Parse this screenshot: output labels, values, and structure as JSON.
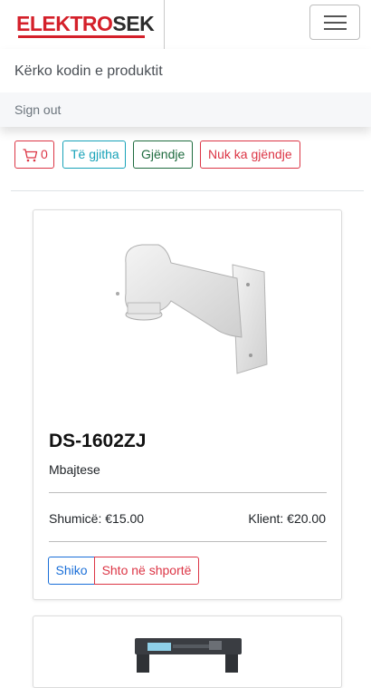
{
  "brand": {
    "part1": "ELEKTRO",
    "part2": "SEK",
    "accent_color": "#d4202a"
  },
  "menu": {
    "search_placeholder": "Kërko kodin e produktit",
    "signout_label": "Sign out"
  },
  "filters": {
    "cart_count": "0",
    "all_label": "Të gjitha",
    "in_stock_label": "Gjëndje",
    "out_of_stock_label": "Nuk ka gjëndje"
  },
  "products": [
    {
      "code": "DS-1602ZJ",
      "description": "Mbajtese",
      "wholesale_price": "Shumicë: €15.00",
      "client_price": "Klient: €20.00",
      "view_label": "Shiko",
      "add_label": "Shto në shportë",
      "image_icon": "wall-mount-bracket-icon"
    },
    {
      "image_icon": "metal-detector-gate-icon"
    }
  ]
}
